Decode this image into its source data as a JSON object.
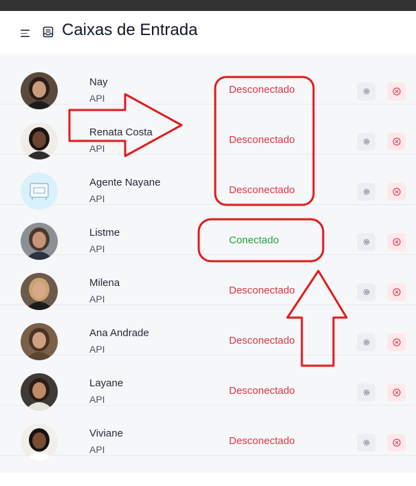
{
  "page": {
    "title": "Caixas de Entrada"
  },
  "icons": {
    "menu": "menu-lines-icon",
    "inbox": "inbox-icon",
    "settings": "gear-icon",
    "delete": "close-circle-icon"
  },
  "colors": {
    "disconnected": "#dc3545",
    "connected": "#22a33b",
    "annotation": "#e01b1b"
  },
  "inboxes": [
    {
      "name": "Nay",
      "type": "API",
      "status": "Desconectado",
      "connected": false
    },
    {
      "name": "Renata Costa",
      "type": "API",
      "status": "Desconectado",
      "connected": false
    },
    {
      "name": "Agente Nayane",
      "type": "API",
      "status": "Desconectado",
      "connected": false
    },
    {
      "name": "Listme",
      "type": "API",
      "status": "Conectado",
      "connected": true
    },
    {
      "name": "Milena",
      "type": "API",
      "status": "Desconectado",
      "connected": false
    },
    {
      "name": "Ana Andrade",
      "type": "API",
      "status": "Desconectado",
      "connected": false
    },
    {
      "name": "Layane",
      "type": "API",
      "status": "Desconectado",
      "connected": false
    },
    {
      "name": "Viviane",
      "type": "API",
      "status": "Desconectado",
      "connected": false
    }
  ]
}
